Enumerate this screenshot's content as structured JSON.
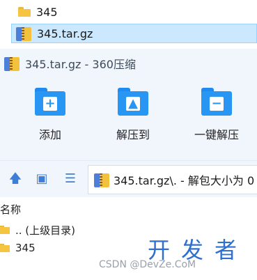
{
  "explorer": {
    "folder_name": "345",
    "archive_name": "345.tar.gz"
  },
  "dialog": {
    "title": "345.tar.gz - 360压缩",
    "toolbar": {
      "add_label": "添加",
      "extract_to_label": "解压到",
      "oneclick_extract_label": "一键解压"
    },
    "path": "345.tar.gz\\. - 解包大小为 0",
    "list": {
      "header_name": "名称",
      "rows": [
        {
          "name": ".. (上级目录)"
        },
        {
          "name": "345"
        }
      ]
    }
  },
  "watermark": {
    "cn": "开发者",
    "csdn": "CSDN @DevZe.CoM",
    "brand": "DevZe.CoM"
  },
  "colors": {
    "accent": "#2996f3",
    "selection": "#cce8ff",
    "folder": "#f5c542",
    "panel": "#f1f6fc"
  }
}
